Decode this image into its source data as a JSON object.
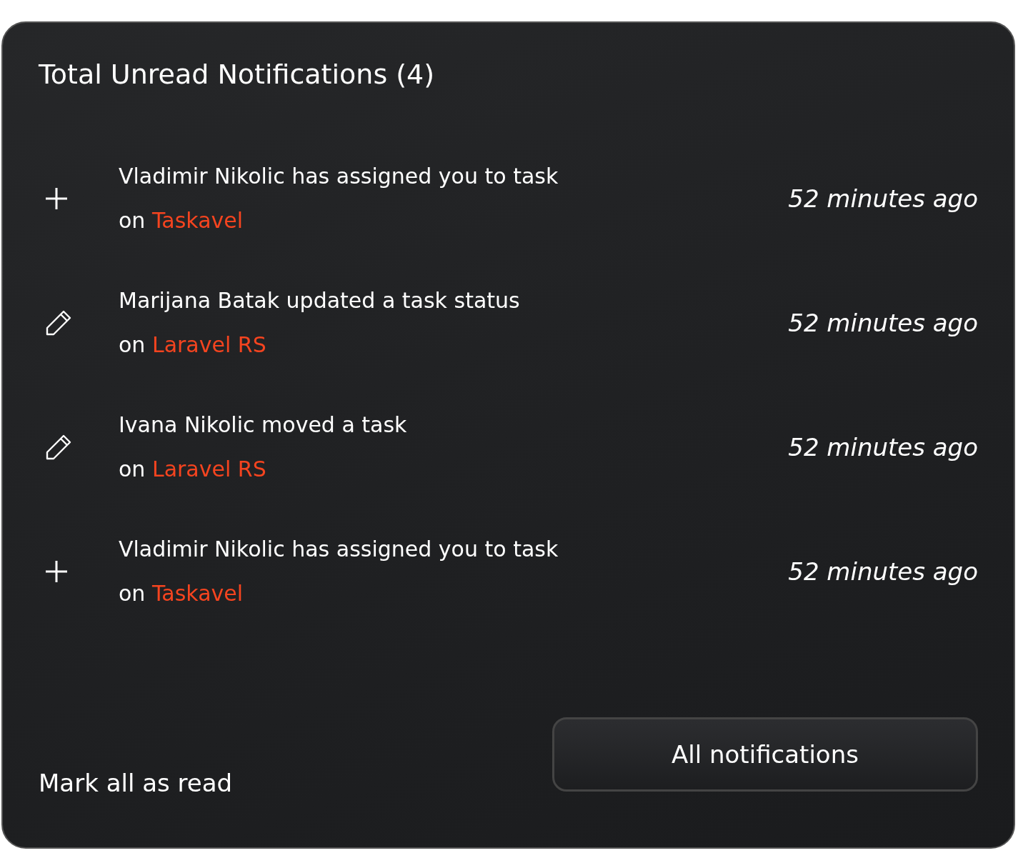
{
  "title": "Total Unread Notifications (4)",
  "notifications": [
    {
      "kind": "assignment",
      "text": "Vladimir Nikolic has assigned you to task",
      "prefix": "on",
      "project": "Taskavel",
      "time": "52 minutes ago"
    },
    {
      "kind": "update",
      "text": "Marijana Batak updated a task status",
      "prefix": "on",
      "project": "Laravel RS",
      "time": "52 minutes ago"
    },
    {
      "kind": "update",
      "text": "Ivana Nikolic moved a task",
      "prefix": "on",
      "project": "Laravel RS",
      "time": "52 minutes ago"
    },
    {
      "kind": "assignment",
      "text": "Vladimir Nikolic has assigned you to task",
      "prefix": "on",
      "project": "Taskavel",
      "time": "52 minutes ago"
    }
  ],
  "mark_all_link": "Mark all as read",
  "all_button": "All notifications"
}
